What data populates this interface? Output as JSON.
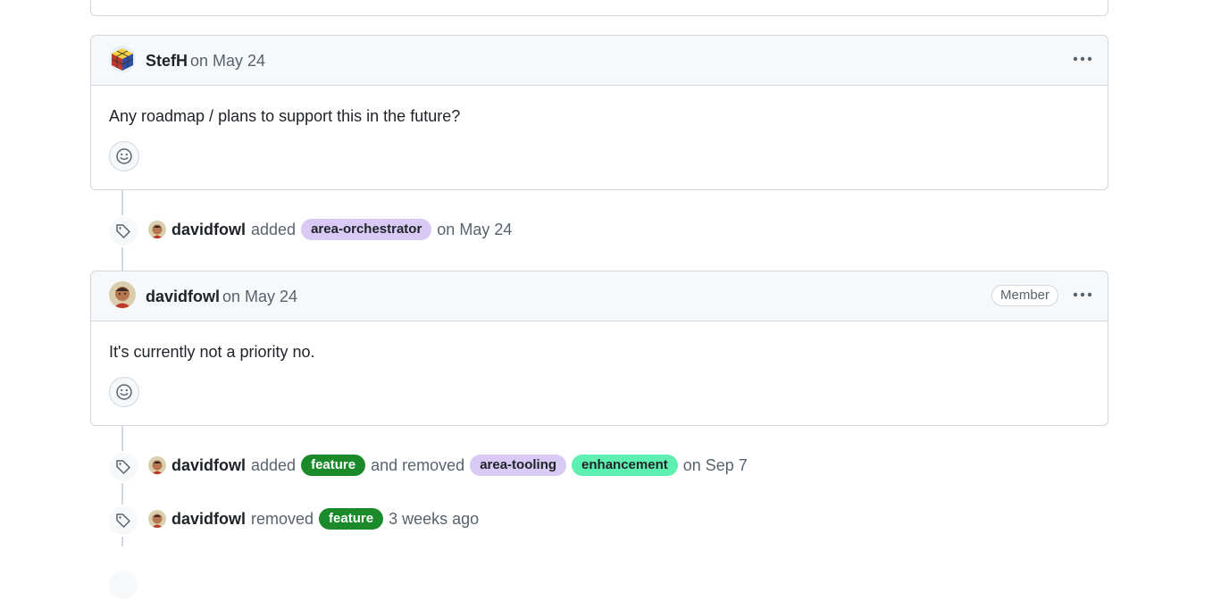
{
  "comments": [
    {
      "author": "StefH",
      "date": "on May 24",
      "body": "Any roadmap / plans to support this in the future?",
      "avatar": "rubiks-cube-avatar",
      "badge": ""
    },
    {
      "author": "davidfowl",
      "date": "on May 24",
      "body": "It's currently not a priority no.",
      "avatar": "davidfowl-avatar",
      "badge": "Member"
    }
  ],
  "events": [
    {
      "actor": "davidfowl",
      "action": "added",
      "labels": [
        {
          "name": "area-orchestrator",
          "bg": "#d8c9f5",
          "fg": "#1f2328"
        }
      ],
      "date": "on May 24"
    },
    {
      "actor": "davidfowl",
      "action": "added",
      "labels_added": [
        {
          "name": "feature",
          "bg": "#1a8a2a",
          "fg": "#ffffff"
        }
      ],
      "connector": "and removed",
      "labels_removed": [
        {
          "name": "area-tooling",
          "bg": "#d8c9f5",
          "fg": "#1f2328"
        },
        {
          "name": "enhancement",
          "bg": "#5ef0b0",
          "fg": "#1f2328"
        }
      ],
      "date": "on Sep 7"
    },
    {
      "actor": "davidfowl",
      "action": "removed",
      "labels": [
        {
          "name": "feature",
          "bg": "#1a8a2a",
          "fg": "#ffffff"
        }
      ],
      "date": "3 weeks ago"
    }
  ],
  "icons": {
    "menu": "kebab-horizontal-icon",
    "reaction": "smiley-icon",
    "label_event": "tag-icon"
  },
  "colors": {
    "border": "#d0d7de",
    "header_bg": "#f6f8fa",
    "muted_text": "#59636e"
  }
}
